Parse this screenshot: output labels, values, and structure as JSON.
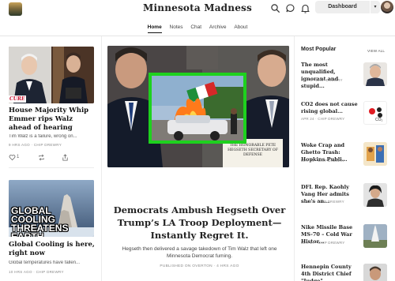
{
  "header": {
    "site_title": "Minnesota Madness",
    "icons": [
      "search-icon",
      "chat-bubble-icon",
      "bell-icon"
    ],
    "dashboard_label": "Dashboard",
    "caret": "▾"
  },
  "nav": {
    "tabs": [
      "Home",
      "Notes",
      "Chat",
      "Archive",
      "About"
    ],
    "active": "Home"
  },
  "left_posts": [
    {
      "title": "House Majority Whip Emmer rips Walz ahead of hearing",
      "subtitle": "Tim Walz is a failure, wrong on...",
      "meta": "9 HRS AGO · CHIP DREWRY",
      "likes": "1",
      "image_overlay": "CURE"
    },
    {
      "title": "Global Cooling is here, right now",
      "subtitle": "Global temperatures have fallen...",
      "meta": "10 HRS AGO · CHIP DREWRY",
      "image_overlay": "GLOBAL COOLING THREATENS EARTH"
    }
  ],
  "hero": {
    "title": "Democrats Ambush Hegseth Over Trump’s LA Troop Deployment—Instantly Regret It.",
    "subtitle": "Hegseth then delivered a savage takedown of Tim Walz that left one Minnesota Democrat fuming.",
    "meta": "PUBLISHED ON OVERTON · 4 HRS AGO",
    "placard": "THE HONORABLE PETE HEGSETH SECRETARY OF DEFENSE",
    "inset_border_color": "#1ed11e"
  },
  "sidebar": {
    "heading": "Most Popular",
    "view_all": "VIEW ALL",
    "items": [
      {
        "title": "The most unqualified, ignorant and stupid...",
        "meta": "MAY 8 · CHIP DREWRY"
      },
      {
        "title": "CO2 does not cause rising global...",
        "meta": "APR 24 · CHIP DREWRY"
      },
      {
        "title": "Woke Crap and Ghetto Trash: Hopkins Publi...",
        "meta": "MAY 29 · CHIP DREWRY"
      },
      {
        "title": "DFL Rep. Kaohly Vang Her admits she's an...",
        "meta": "JUN 10 · CHIP DREWRY"
      },
      {
        "title": "Nike Missile Base MS-70 – Cold War Histor...",
        "meta": "MAY 27 · CHIP DREWRY"
      },
      {
        "title": "Hennepin County 4th District Chief \"Judge\"...",
        "meta": ""
      }
    ],
    "co2_label": "CO₂"
  }
}
